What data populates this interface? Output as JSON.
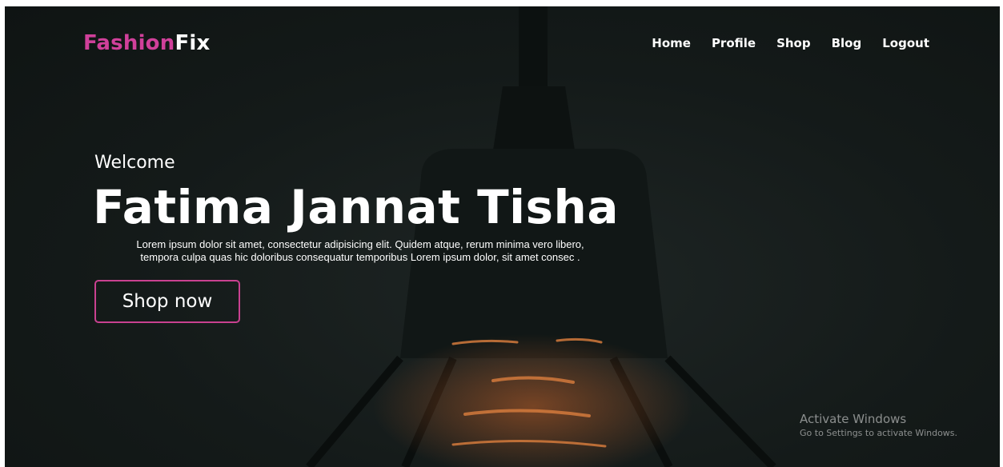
{
  "nav": {
    "logo": {
      "part1": "Fashion",
      "part2": "Fix"
    },
    "links": [
      {
        "label": "Home"
      },
      {
        "label": "Profile"
      },
      {
        "label": "Shop"
      },
      {
        "label": "Blog"
      },
      {
        "label": "Logout"
      }
    ]
  },
  "hero": {
    "greeting": "Welcome",
    "name": "Fatima Jannat Tisha",
    "description_line1": "Lorem ipsum dolor sit amet, consectetur adipisicing elit. Quidem atque, rerum minima vero libero,",
    "description_line2": "tempora culpa quas hic doloribus consequatur temporibus Lorem ipsum dolor, sit amet consec .",
    "button_label": "Shop now"
  },
  "watermark": {
    "title": "Activate Windows",
    "subtitle": "Go to Settings to activate Windows."
  },
  "colors": {
    "brand_accent": "#d0409a",
    "button_border": "#c94190",
    "background": "#141a19",
    "text": "#ffffff"
  }
}
